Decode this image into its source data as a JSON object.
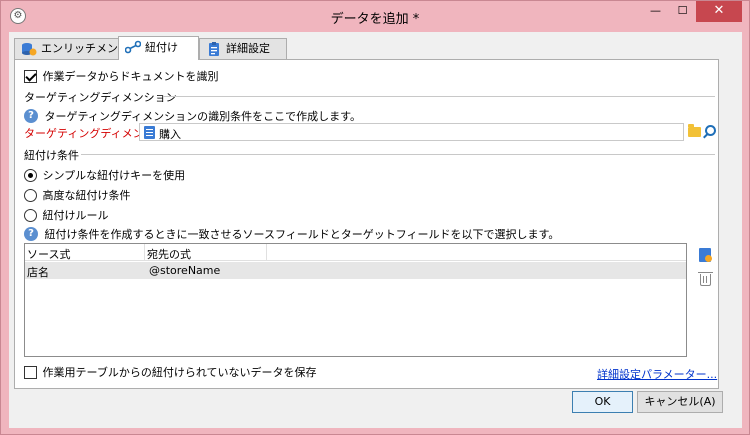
{
  "window": {
    "title": "データを追加 *",
    "minimize": "—",
    "maximize": "☐",
    "close": "✕"
  },
  "tabs": [
    {
      "label": "エンリッチメント",
      "icon": "enrichment-icon"
    },
    {
      "label": "紐付け",
      "icon": "link-icon"
    },
    {
      "label": "詳細設定",
      "icon": "clipboard-icon"
    }
  ],
  "identify_checkbox": {
    "label": "作業データからドキュメントを識別",
    "checked": true
  },
  "targeting": {
    "section": "ターゲティングディメンション",
    "help": "ターゲティングディメンションの識別条件をここで作成します。",
    "field_label": "ターゲティングディメンション:",
    "field_value": "購入"
  },
  "reconciliation": {
    "section": "紐付け条件",
    "options": [
      {
        "label": "シンプルな紐付けキーを使用",
        "selected": true
      },
      {
        "label": "高度な紐付け条件",
        "selected": false
      },
      {
        "label": "紐付けルール",
        "selected": false
      }
    ],
    "help": "紐付け条件を作成するときに一致させるソースフィールドとターゲットフィールドを以下で選択します。"
  },
  "grid": {
    "columns": [
      "ソース式",
      "宛先の式"
    ],
    "rows": [
      {
        "source": "店名",
        "dest": "@storeName"
      }
    ]
  },
  "footer": {
    "keep_unreconciled": {
      "label": "作業用テーブルからの紐付けられていないデータを保存",
      "checked": false
    },
    "advanced_link": "詳細設定パラメーター..."
  },
  "buttons": {
    "ok": "OK",
    "cancel": "キャンセル(A)"
  },
  "colors": {
    "titlebar": "#f0b5be",
    "close": "#c7474f",
    "required_label": "#d40000",
    "link": "#0033cc"
  }
}
